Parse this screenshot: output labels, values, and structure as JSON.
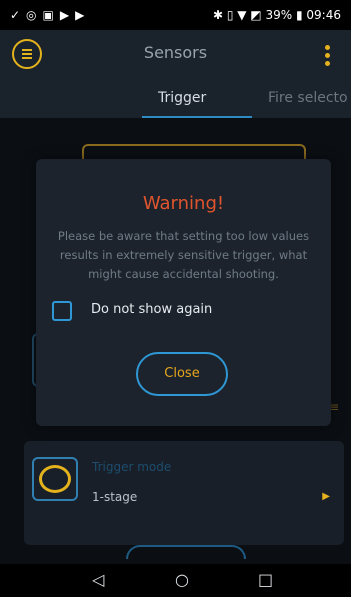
{
  "status": {
    "time": "09:46",
    "battery": "39%"
  },
  "app": {
    "title": "Sensors"
  },
  "tabs": [
    {
      "label": "Trigger"
    },
    {
      "label": "Fire selecto"
    }
  ],
  "modal": {
    "title": "Warning!",
    "message": "Please be aware that setting too low values results in extremely sensitive trigger, what might cause accidental shooting.",
    "checkbox_label": "Do not show again",
    "checkbox_checked": false,
    "close_label": "Close"
  },
  "trigger_mode": {
    "title": "Trigger mode",
    "value": "1-stage"
  },
  "colors": {
    "accent": "#e4b21d",
    "blue": "#2f97d4",
    "warning": "#e0552d"
  }
}
